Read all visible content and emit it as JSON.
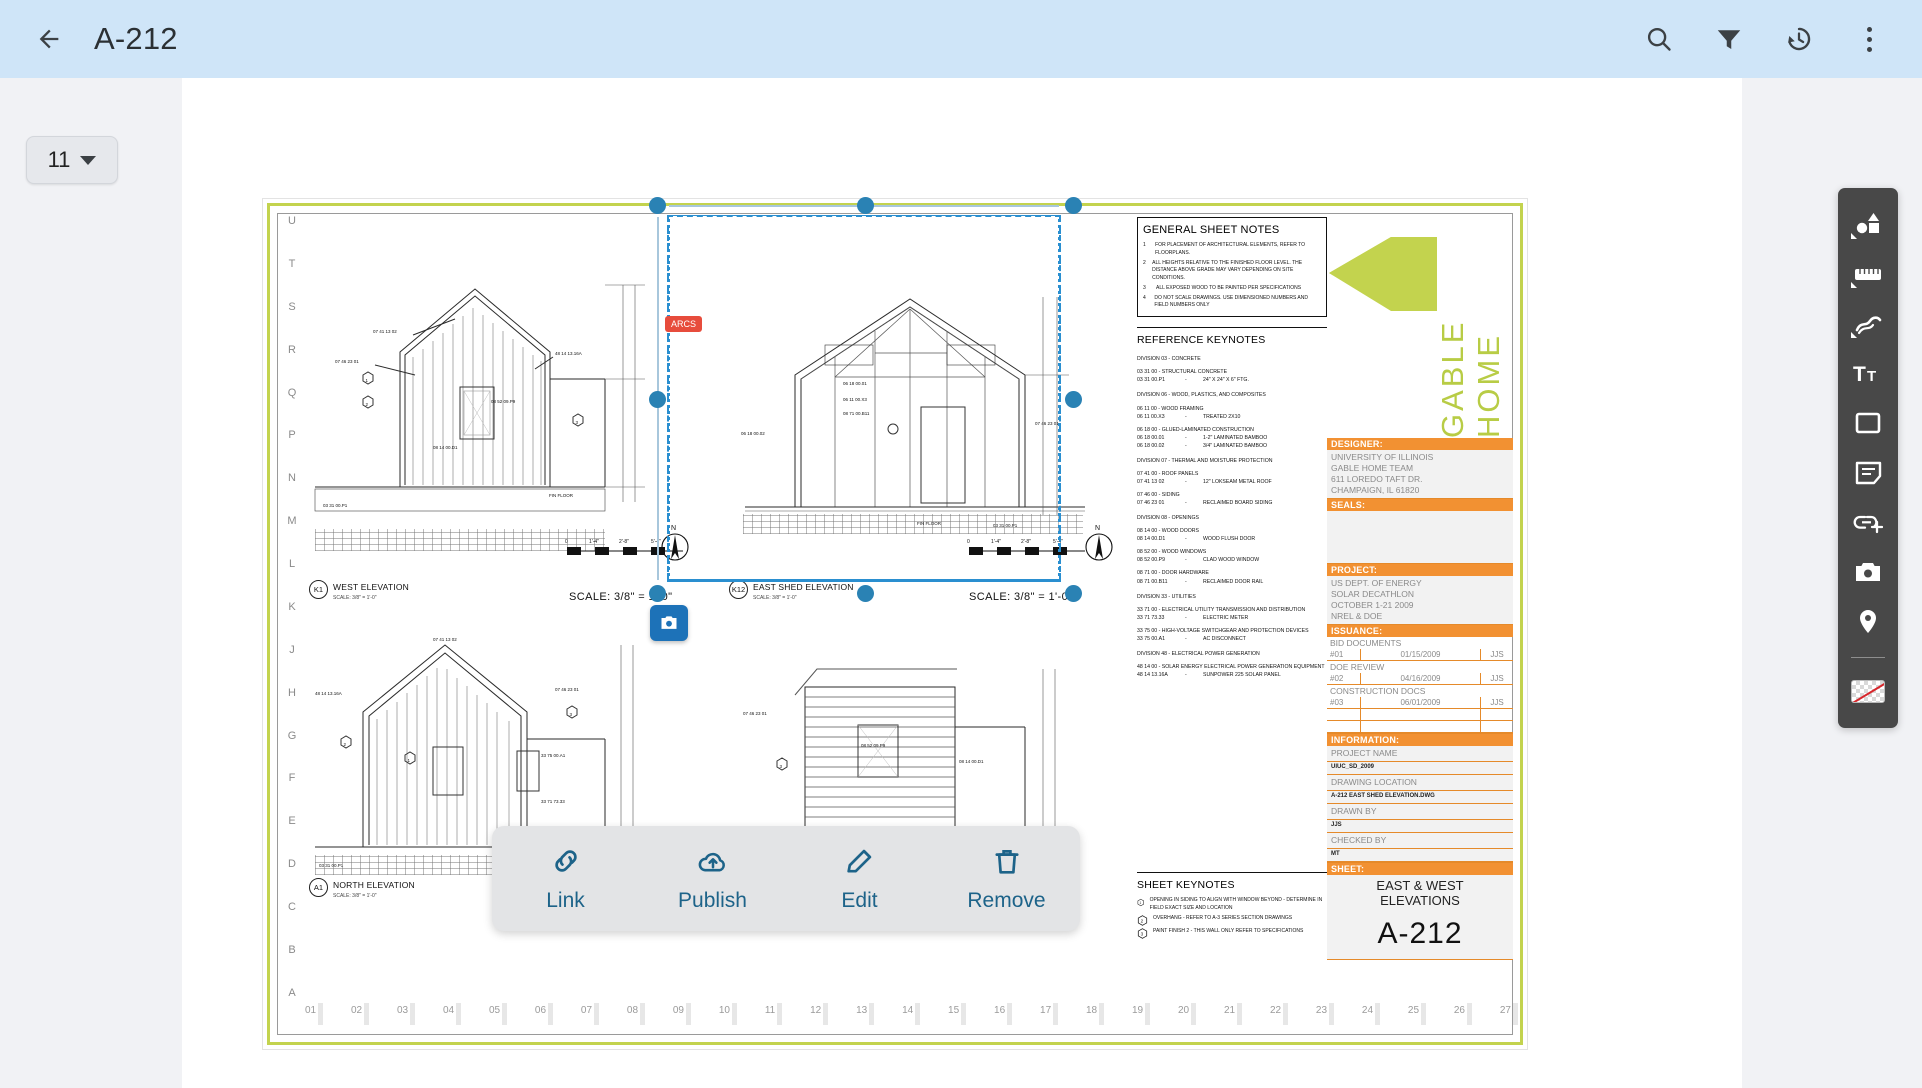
{
  "header": {
    "title": "A-212",
    "back_icon": "back-arrow-icon",
    "actions": [
      {
        "name": "search-icon",
        "label": "Search"
      },
      {
        "name": "filter-icon",
        "label": "Filter"
      },
      {
        "name": "history-icon",
        "label": "History"
      },
      {
        "name": "overflow-menu-icon",
        "label": "More options"
      }
    ]
  },
  "page_selector": {
    "value": "11"
  },
  "action_bar": {
    "items": [
      {
        "icon": "link-icon",
        "label": "Link"
      },
      {
        "icon": "cloud-upload-icon",
        "label": "Publish"
      },
      {
        "icon": "pencil-icon",
        "label": "Edit"
      },
      {
        "icon": "trash-icon",
        "label": "Remove"
      }
    ]
  },
  "markup_badge": {
    "label": "ARCS"
  },
  "toolbar": {
    "tools": [
      {
        "name": "shapes-tool-icon",
        "label": "Shapes"
      },
      {
        "name": "measure-ruler-tool-icon",
        "label": "Measure"
      },
      {
        "name": "freehand-scribble-tool-icon",
        "label": "Freehand"
      },
      {
        "name": "text-tool-icon",
        "label": "Text"
      },
      {
        "name": "rectangle-tool-icon",
        "label": "Rectangle"
      },
      {
        "name": "note-tool-icon",
        "label": "Note"
      },
      {
        "name": "add-link-tool-icon",
        "label": "Add Link"
      },
      {
        "name": "camera-tool-icon",
        "label": "Photo"
      },
      {
        "name": "location-pin-tool-icon",
        "label": "Pin"
      }
    ],
    "swatch_label": "No fill"
  },
  "sheet": {
    "row_marks": [
      "A",
      "B",
      "C",
      "D",
      "E",
      "F",
      "G",
      "H",
      "J",
      "K",
      "L",
      "M",
      "N",
      "P",
      "Q",
      "R",
      "S",
      "T",
      "U"
    ],
    "col_marks": [
      "01",
      "02",
      "03",
      "04",
      "05",
      "06",
      "07",
      "08",
      "09",
      "10",
      "11",
      "12",
      "13",
      "14",
      "15",
      "16",
      "17",
      "18",
      "19",
      "20",
      "21",
      "22",
      "23",
      "24",
      "25",
      "26",
      "27"
    ],
    "brand": "GABLE HOME",
    "elevations": [
      {
        "bubble": "K1",
        "name": "WEST ELEVATION",
        "sub": "SCALE: 3/8\" = 1'-0\"",
        "scale": "SCALE: 3/8\" = 1'-0\"",
        "ruler": [
          "0",
          "1'-4\"",
          "2'-8\"",
          "5'-4\""
        ]
      },
      {
        "bubble": "K12",
        "name": "EAST SHED ELEVATION",
        "sub": "SCALE: 3/8\" = 1'-0\"",
        "scale": "SCALE: 3/8\" = 1'-0\"",
        "ruler": [
          "0",
          "1'-4\"",
          "2'-8\"",
          "5'-4\""
        ]
      },
      {
        "bubble": "A1",
        "name": "NORTH ELEVATION",
        "sub": "SCALE: 3/8\" = 1'-0\"",
        "scale": "",
        "ruler": []
      },
      {
        "bubble": "",
        "name": "",
        "sub": "",
        "scale": "",
        "ruler": []
      }
    ],
    "general_notes": {
      "title": "GENERAL SHEET NOTES",
      "items": [
        {
          "num": "1",
          "text": "FOR PLACEMENT OF ARCHITECTURAL ELEMENTS, REFER TO FLOORPLANS."
        },
        {
          "num": "2",
          "text": "ALL HEIGHTS RELATIVE TO THE FINISHED FLOOR LEVEL. THE DISTANCE ABOVE GRADE MAY VARY DEPENDING ON SITE CONDITIONS."
        },
        {
          "num": "3",
          "text": "ALL EXPOSED WOOD TO BE PAINTED PER SPECIFICATIONS"
        },
        {
          "num": "4",
          "text": "DO NOT SCALE DRAWINGS. USE DIMENSIONED NUMBERS AND FIELD NUMBERS ONLY"
        }
      ]
    },
    "reference_keynotes": {
      "title": "REFERENCE KEYNOTES",
      "groups": [
        {
          "division": "DIVISION 03 - CONCRETE",
          "entries": [
            {
              "code": "03 31 00",
              "text": "STRUCTURAL CONCRETE",
              "is_group": true
            },
            {
              "code": "03 31 00.P1",
              "dash": "-",
              "text": "24\" X 24\" X 6\" FTG."
            }
          ]
        },
        {
          "division": "DIVISION 06 - WOOD, PLASTICS, AND COMPOSITES",
          "entries": [
            {
              "code": "06 11 00",
              "text": "WOOD FRAMING",
              "is_group": true
            },
            {
              "code": "06 11 00.X3",
              "dash": "-",
              "text": "TREATED 2X10"
            },
            {
              "code": "06 18 00",
              "text": "GLUED-LAMINATED CONSTRUCTION",
              "is_group": true
            },
            {
              "code": "06 18 00.01",
              "dash": "-",
              "text": "1-2\" LAMINATED BAMBOO"
            },
            {
              "code": "06 18 00.02",
              "dash": "-",
              "text": "3/4\" LAMINATED BAMBOO"
            }
          ]
        },
        {
          "division": "DIVISION 07 - THERMAL AND MOISTURE PROTECTION",
          "entries": [
            {
              "code": "07 41 00",
              "text": "ROOF PANELS",
              "is_group": true
            },
            {
              "code": "07 41 13 02",
              "dash": "-",
              "text": "12\" LOKSEAM METAL ROOF"
            },
            {
              "code": "07 46 00",
              "text": "SIDING",
              "is_group": true
            },
            {
              "code": "07 46 23 01",
              "dash": "-",
              "text": "RECLAIMED BOARD SIDING"
            }
          ]
        },
        {
          "division": "DIVISION 08 - OPENINGS",
          "entries": [
            {
              "code": "08 14 00",
              "text": "WOOD DOORS",
              "is_group": true
            },
            {
              "code": "08 14 00.D1",
              "dash": "-",
              "text": "WOOD FLUSH DOOR"
            },
            {
              "code": "08 52 00",
              "text": "WOOD WINDOWS",
              "is_group": true
            },
            {
              "code": "08 52 00.P9",
              "dash": "-",
              "text": "CLAD WOOD WINDOW"
            },
            {
              "code": "08 71 00",
              "text": "DOOR HARDWARE",
              "is_group": true
            },
            {
              "code": "08 71 00.B11",
              "dash": "-",
              "text": "RECLAIMED DOOR RAIL"
            }
          ]
        },
        {
          "division": "DIVISION 33 - UTILITIES",
          "entries": [
            {
              "code": "33 71 00",
              "text": "ELECTRICAL UTILITY TRANSMISSION AND DISTRIBUTION",
              "is_group": true
            },
            {
              "code": "33 71 73.33",
              "dash": "-",
              "text": "ELECTRIC METER"
            },
            {
              "code": "33 75 00",
              "text": "HIGH-VOLTAGE SWITCHGEAR AND PROTECTION DEVICES",
              "is_group": true
            },
            {
              "code": "33 75 00.A1",
              "dash": "-",
              "text": "AC DISCONNECT"
            }
          ]
        },
        {
          "division": "DIVISION 48 - ELECTRICAL POWER GENERATION",
          "entries": [
            {
              "code": "48 14 00",
              "text": "SOLAR ENERGY ELECTRICAL POWER GENERATION EQUIPMENT",
              "is_group": true
            },
            {
              "code": "48 14 13.16A",
              "dash": "-",
              "text": "SUNPOWER 225 SOLAR PANEL"
            }
          ]
        }
      ]
    },
    "sheet_keynotes": {
      "title": "SHEET KEYNOTES",
      "items": [
        {
          "num": "1",
          "text": "OPENING IN SIDING TO ALIGN WITH WINDOW BEYOND - DETERMINE IN FIELD EXACT SIZE AND LOCATION"
        },
        {
          "num": "2",
          "text": "OVERHANG - REFER TO A-3 SERIES SECTION DRAWINGS"
        },
        {
          "num": "3",
          "text": "PAINT FINISH 2 - THIS WALL ONLY REFER TO SPECIFICATIONS"
        }
      ]
    },
    "title_block": {
      "designer": {
        "head": "DESIGNER:",
        "lines": "UNIVERSITY OF ILLINOIS\nGABLE HOME TEAM\n611 LOREDO TAFT DR.\nCHAMPAIGN, IL 61820"
      },
      "seals": {
        "head": "SEALS:"
      },
      "project": {
        "head": "PROJECT:",
        "lines": "US DEPT. OF ENERGY\nSOLAR DECATHLON\nOCTOBER 1-21 2009\nNREL & DOE"
      },
      "issuance": {
        "head": "ISSUANCE:",
        "rows": [
          {
            "name": "BID DOCUMENTS",
            "num": "#01",
            "date": "01/15/2009",
            "by": "JJS"
          },
          {
            "name": "DOE REVIEW",
            "num": "#02",
            "date": "04/16/2009",
            "by": "JJS"
          },
          {
            "name": "CONSTRUCTION DOCS",
            "num": "#03",
            "date": "06/01/2009",
            "by": "JJS"
          }
        ]
      },
      "information": {
        "head": "INFORMATION:",
        "fields": [
          {
            "label": "PROJECT NAME",
            "value": "UIUC_SD_2009"
          },
          {
            "label": "DRAWING LOCATION",
            "value": "A-212 EAST SHED ELEVATION.DWG"
          },
          {
            "label": "DRAWN BY",
            "value": "JJS"
          },
          {
            "label": "CHECKED BY",
            "value": "MT"
          }
        ]
      },
      "sheet": {
        "head": "SHEET:",
        "title": "EAST & WEST\nELEVATIONS",
        "number": "A-212"
      }
    }
  },
  "colors": {
    "header_bg": "#cfe5f8",
    "accent_blue": "#2a82b4",
    "action_blue": "#1d6389",
    "sheet_green": "#c3d34e",
    "title_orange": "#f29132",
    "toolbar_bg": "#484848",
    "badge_red": "#e74c3c"
  }
}
